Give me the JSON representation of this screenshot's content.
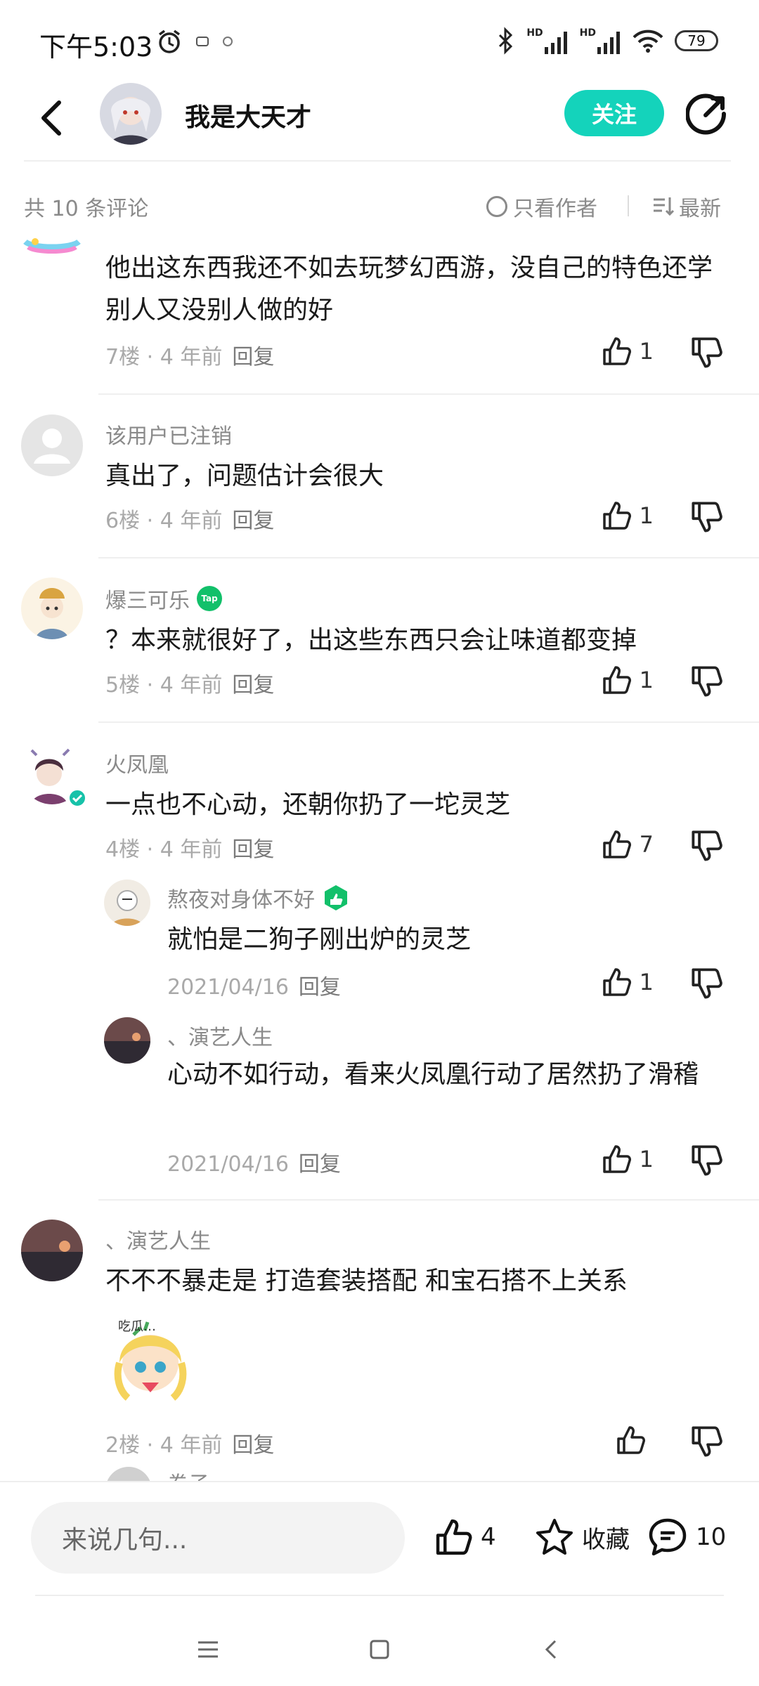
{
  "status": {
    "time": "下午5:03",
    "battery": "79",
    "hd1": "HD",
    "hd2": "HD"
  },
  "header": {
    "author_name": "我是大天才",
    "follow_label": "关注"
  },
  "comments_bar": {
    "total": "共 10 条评论",
    "only_author": "只看作者",
    "sort": "最新"
  },
  "comments": [
    {
      "text": "他出这东西我还不如去玩梦幻西游，没自己的特色还学别人又没别人做的好",
      "floor": "7楼",
      "time": "4 年前",
      "reply": "回复",
      "likes": "1"
    },
    {
      "name": "该用户已注销",
      "text": "真出了，问题估计会很大",
      "floor": "6楼",
      "time": "4 年前",
      "reply": "回复",
      "likes": "1"
    },
    {
      "name": "爆三可乐",
      "badge": "Tap",
      "text": "？本来就很好了，出这些东西只会让味道都变掉",
      "floor": "5楼",
      "time": "4 年前",
      "reply": "回复",
      "likes": "1"
    },
    {
      "name": "火凤凰",
      "text": "一点也不心动，还朝你扔了一坨灵芝",
      "floor": "4楼",
      "time": "4 年前",
      "reply": "回复",
      "likes": "7",
      "replies": [
        {
          "name": "熬夜对身体不好",
          "text": "就怕是二狗子刚出炉的灵芝",
          "date": "2021/04/16",
          "reply": "回复",
          "likes": "1"
        },
        {
          "name": "、演艺人生",
          "text": "心动不如行动，看来火凤凰行动了居然扔了滑稽",
          "date": "2021/04/16",
          "reply": "回复",
          "likes": "1"
        }
      ]
    },
    {
      "name": "、演艺人生",
      "text": "不不不暴走是 打造套装搭配 和宝石搭不上关系",
      "sticker_text": "吃瓜…",
      "floor": "2楼",
      "time": "4 年前",
      "reply": "回复",
      "likes": ""
    },
    {
      "name": "卷子"
    }
  ],
  "bottom": {
    "input_placeholder": "来说几句...",
    "likes": "4",
    "favorite": "收藏",
    "comments": "10"
  },
  "colors": {
    "accent": "#14d3bb",
    "text_primary": "#1a1a1a",
    "text_secondary": "#8a8a8a",
    "badge_green": "#12c06a"
  },
  "icons": [
    "back-arrow-icon",
    "share-icon",
    "thumb-up-icon",
    "thumb-down-icon",
    "star-icon",
    "comment-bubble-icon",
    "menu-icon",
    "home-square-icon",
    "back-chevron-icon"
  ]
}
